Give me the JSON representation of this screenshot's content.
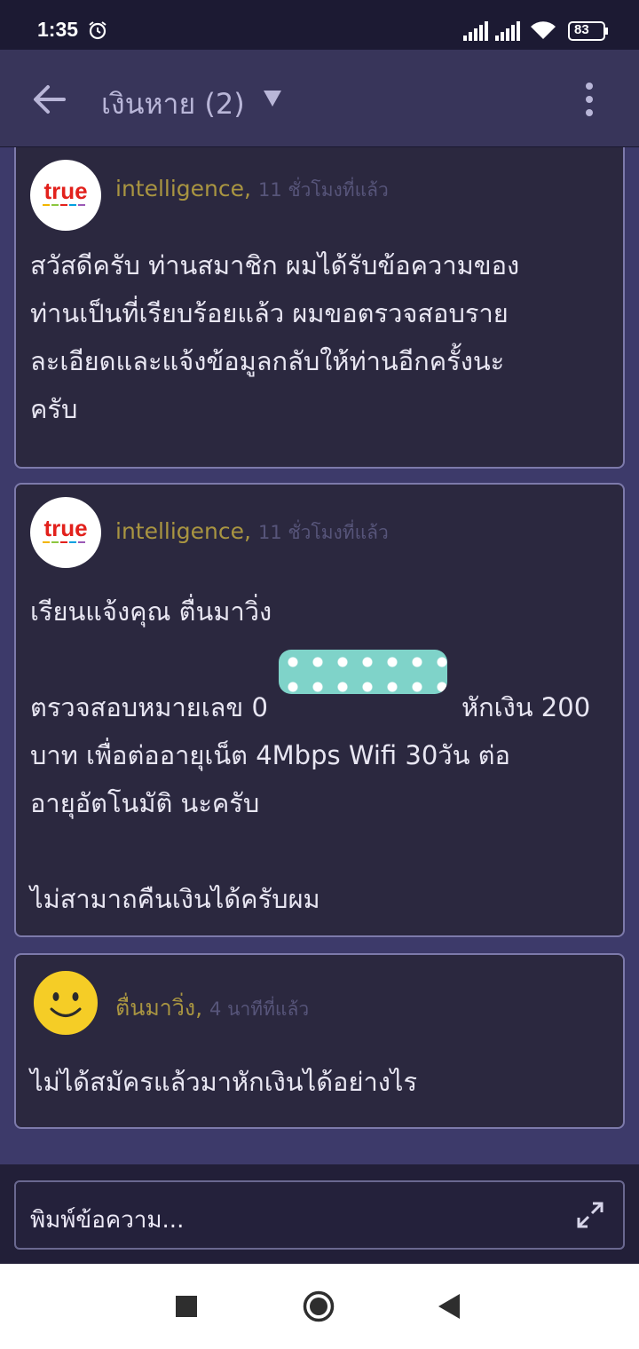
{
  "status_bar": {
    "time": "1:35",
    "battery": "83",
    "icons": [
      "alarm-icon",
      "signal-icon",
      "signal-icon",
      "wifi-icon",
      "battery-icon"
    ]
  },
  "app_bar": {
    "title": "เงินหาย (2)",
    "icons": [
      "back-arrow-icon",
      "dropdown-triangle-icon",
      "more-vert-icon"
    ]
  },
  "messages": [
    {
      "author": "intelligence,",
      "time": "11 ชั่วโมงที่แล้ว",
      "avatar": "true-logo",
      "lines": [
        "สวัสดีครับ ท่านสมาชิก ผมได้รับข้อความของ",
        "ท่านเป็นที่เรียบร้อยแล้ว ผมขอตรวจสอบราย",
        "ละเอียดและแจ้งข้อมูลกลับให้ท่านอีกครั้งนะ",
        "ครับ"
      ]
    },
    {
      "author": "intelligence,",
      "time": "11 ชั่วโมงที่แล้ว",
      "avatar": "true-logo",
      "lines": [
        "เรียนแจ้งคุณ ตื่นมาวิ่ง",
        "",
        "ตรวจสอบหมายเลข 0",
        "หักเงิน 200",
        "บาท เพื่อต่ออายุเน็ต 4Mbps   Wifi 30วัน ต่อ",
        "อายุอัตโนมัติ นะครับ",
        "",
        "ไม่สามาถคืนเงินได้ครับผม"
      ]
    },
    {
      "author": "ตื่นมาวิ่ง,",
      "time": "4 นาทีที่แล้ว",
      "avatar": "smiley-face",
      "lines": [
        "ไม่ได้สมัครแล้วมาหักเงินได้อย่างไร"
      ]
    }
  ],
  "logo_text": "true",
  "input": {
    "placeholder": "พิมพ์ข้อความ..."
  },
  "colors": {
    "author": "#a99541",
    "time": "#57557a",
    "card_border": "#7d7aab",
    "app_bar": "#38355a",
    "feed_bg": "#3d3a6a",
    "logo_red": "#e2211c"
  }
}
